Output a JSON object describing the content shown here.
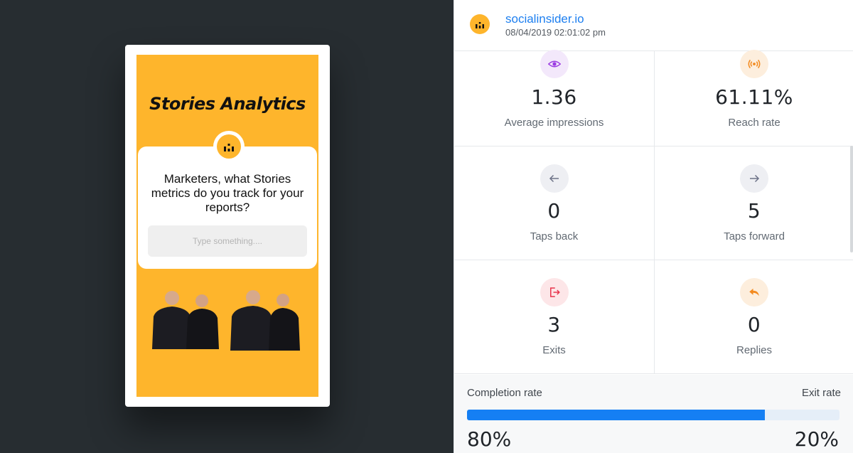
{
  "story": {
    "title": "Stories Analytics",
    "question": "Marketers, what Stories metrics do you track for your reports?",
    "input_placeholder": "Type something...."
  },
  "header": {
    "account_name": "socialinsider.io",
    "timestamp": "08/04/2019 02:01:02 pm"
  },
  "metrics": [
    {
      "icon": "eye-icon",
      "value": "1.36",
      "label": "Average impressions",
      "icon_bg": "#f3e8fb",
      "icon_color": "#9b3ce2"
    },
    {
      "icon": "broadcast-icon",
      "value": "61.11%",
      "label": "Reach rate",
      "icon_bg": "#fdeedd",
      "icon_color": "#f38a1e"
    },
    {
      "icon": "arrow-left-icon",
      "value": "0",
      "label": "Taps back",
      "icon_bg": "#eeeff3",
      "icon_color": "#6e7388"
    },
    {
      "icon": "arrow-right-icon",
      "value": "5",
      "label": "Taps forward",
      "icon_bg": "#eeeff3",
      "icon_color": "#6e7388"
    },
    {
      "icon": "exit-icon",
      "value": "3",
      "label": "Exits",
      "icon_bg": "#fde6e8",
      "icon_color": "#e8334b"
    },
    {
      "icon": "reply-icon",
      "value": "0",
      "label": "Replies",
      "icon_bg": "#fdeedd",
      "icon_color": "#f38a1e"
    }
  ],
  "rates": {
    "completion_label": "Completion rate",
    "exit_label": "Exit rate",
    "completion_value": "80%",
    "exit_value": "20%",
    "completion_fraction": 0.8
  },
  "colors": {
    "brand": "#feb52c",
    "accent": "#157ff3",
    "dark_bg": "#272d31"
  }
}
